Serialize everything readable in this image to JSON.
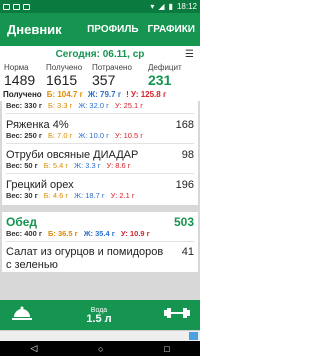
{
  "statusbar": {
    "time": "18:12"
  },
  "appbar": {
    "title": "Дневник",
    "profile": "ПРОФИЛЬ",
    "charts": "ГРАФИКИ"
  },
  "date": {
    "label": "Сегодня: 06.11, ср"
  },
  "stats": {
    "headers": [
      "Норма",
      "Получено",
      "Потрачено",
      "Дефицит"
    ],
    "values": [
      "1489",
      "1615",
      "357",
      "231"
    ]
  },
  "received": {
    "label": "Получено",
    "b": "Б: 104.7 г",
    "z": "Ж: 79.7 г",
    "u": "! У: 125.8 г"
  },
  "items": [
    {
      "name": "",
      "calories": "",
      "weight": "Вес: 330 г",
      "b": "Б: 3.3 г",
      "z": "Ж: 32.0 г",
      "u": "У: 25.1 г"
    },
    {
      "name": "Ряженка 4%",
      "calories": "168",
      "weight": "Вес: 250 г",
      "b": "Б: 7.0 г",
      "z": "Ж: 10.0 г",
      "u": "У: 10.5 г"
    },
    {
      "name": "Отруби овсяные ДИАДАР",
      "calories": "98",
      "weight": "Вес: 50 г",
      "b": "Б: 5.4 г",
      "z": "Ж: 3.3 г",
      "u": "У: 8.6 г"
    },
    {
      "name": "Грецкий орех",
      "calories": "196",
      "weight": "Вес: 30 г",
      "b": "Б: 4.6 г",
      "z": "Ж: 18.7 г",
      "u": "У: 2.1 г"
    }
  ],
  "meal": {
    "name": "Обед",
    "calories": "503",
    "weight": "Вес: 400 г",
    "b": "Б: 36.5 г",
    "z": "Ж: 35.4 г",
    "u": "У: 10.9 г"
  },
  "meal_items": [
    {
      "name": "Салат из огурцов и помидоров с зеленью",
      "calories": "41"
    }
  ],
  "water": {
    "label": "Вода",
    "amount": "1.5 л"
  }
}
